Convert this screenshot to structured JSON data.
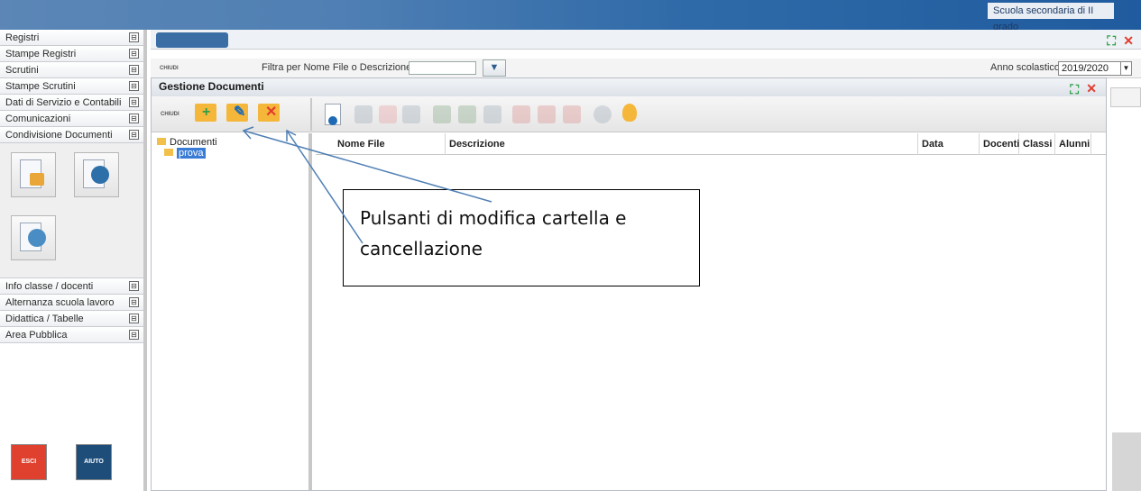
{
  "header": {
    "school": "Scuola secondaria di II grado"
  },
  "sidebar": {
    "items": [
      {
        "label": "Registri"
      },
      {
        "label": "Stampe Registri"
      },
      {
        "label": "Scrutini"
      },
      {
        "label": "Stampe Scrutini"
      },
      {
        "label": "Dati di Servizio e Contabili"
      },
      {
        "label": "Comunicazioni"
      },
      {
        "label": "Condivisione Documenti"
      }
    ],
    "items_bottom": [
      {
        "label": "Info classe / docenti"
      },
      {
        "label": "Alternanza scuola lavoro"
      },
      {
        "label": "Didattica / Tabelle"
      },
      {
        "label": "Area Pubblica"
      }
    ],
    "expand_glyph": "⊟",
    "buttons": {
      "exit": "ESCI",
      "help": "AIUTO"
    },
    "colors": {
      "exit": "#e0402e",
      "help": "#1f4d7a"
    }
  },
  "filter_bar": {
    "close_label": "CHIUDI",
    "filter_label": "Filtra per Nome File o Descrizione:",
    "filter_value": "",
    "year_label": "Anno scolastico:",
    "year_value": "2019/2020"
  },
  "dialog": {
    "title": "Gestione Documenti",
    "close_label": "CHIUDI",
    "tree": {
      "root": "Documenti",
      "child": "prova"
    },
    "columns": [
      "Nome File",
      "Descrizione",
      "Data",
      "Docenti",
      "Classi",
      "Alunni"
    ]
  },
  "callout": {
    "text": "Pulsanti di modifica cartella e cancellazione"
  },
  "colors": {
    "accent": "#2f6aa8",
    "selected": "#3a7bd5",
    "folder": "#f5b73a",
    "delete": "#e23b2e",
    "grid_icon": "#2fa04a"
  }
}
